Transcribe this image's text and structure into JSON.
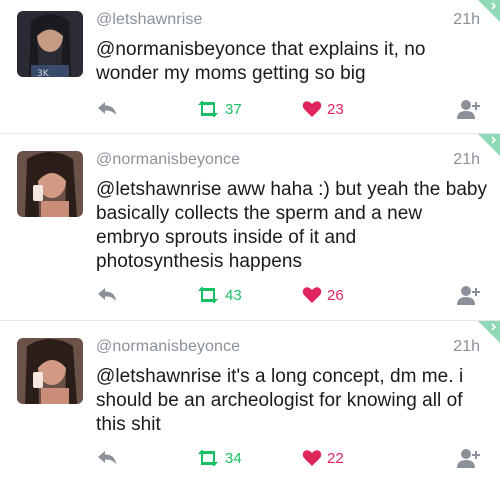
{
  "colors": {
    "retweet": "#17bf63",
    "like": "#e0245e",
    "muted": "#8a9199",
    "text": "#1a1a1a",
    "divider": "#e3e6e8"
  },
  "tweets": [
    {
      "handle": "@letshawnrise",
      "time": "21h",
      "text": "@normanisbeyonce that explains it, no wonder my moms getting so big",
      "retweets": "37",
      "likes": "23",
      "icons": {
        "reply": "reply-icon",
        "retweet": "retweet-icon",
        "like": "heart-icon",
        "follow": "follow-icon"
      }
    },
    {
      "handle": "@normanisbeyonce",
      "time": "21h",
      "text": "@letshawnrise aww haha :) but yeah the baby basically collects the sperm and a new embryo sprouts inside of it and photosynthesis happens",
      "retweets": "43",
      "likes": "26",
      "icons": {
        "reply": "reply-icon",
        "retweet": "retweet-icon",
        "like": "heart-icon",
        "follow": "follow-icon"
      }
    },
    {
      "handle": "@normanisbeyonce",
      "time": "21h",
      "text": "@letshawnrise it's a long concept, dm me. i should be an archeologist for knowing all of this shit",
      "retweets": "34",
      "likes": "22",
      "icons": {
        "reply": "reply-icon",
        "retweet": "retweet-icon",
        "like": "heart-icon",
        "follow": "follow-icon"
      }
    }
  ]
}
